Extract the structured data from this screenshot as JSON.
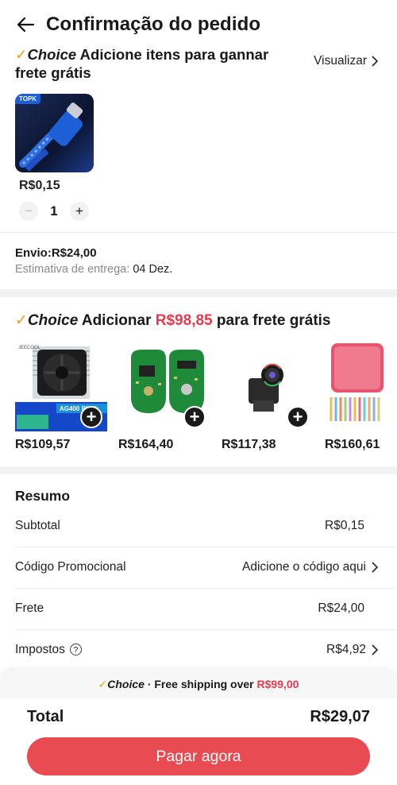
{
  "header": {
    "title": "Confirmação do pedido"
  },
  "choice_promo": {
    "choice_label": "Choice",
    "text": "Adicione itens para gannar frete grátis",
    "link": "Visualizar"
  },
  "cart_item": {
    "brand_tag": "TOPK",
    "price": "R$0,15",
    "quantity": "1"
  },
  "shipping": {
    "label": "Envio:R$24,00",
    "delivery_label": "Estimativa de entrega:",
    "delivery_date": "04 Dez."
  },
  "add_more": {
    "choice_label": "Choice",
    "text_before": "Adicionar",
    "amount": "R$98,85",
    "text_after": "para frete grátis",
    "items": [
      {
        "price": "R$109,57",
        "image": "cpu-cooler",
        "caption": "AG400 Black"
      },
      {
        "price": "R$164,40",
        "image": "circuit-boards"
      },
      {
        "price": "R$117,38",
        "image": "camera-module"
      },
      {
        "price": "R$160,61",
        "image": "pink-case"
      }
    ]
  },
  "summary": {
    "title": "Resumo",
    "rows": [
      {
        "label": "Subtotal",
        "value": "R$0,15"
      },
      {
        "label": "Código Promocional",
        "value": "Adicione o código aqui"
      },
      {
        "label": "Frete",
        "value": "R$24,00"
      },
      {
        "label": "Impostos",
        "value": "R$4,92"
      }
    ]
  },
  "footer": {
    "choice_label": "Choice",
    "banner_text": "· Free shipping over",
    "banner_amount": "R$99,00",
    "total_label": "Total",
    "total_value": "R$29,07",
    "pay_label": "Pagar agora"
  },
  "colors": {
    "accent_red": "#e8394d",
    "button_red": "#e84b52",
    "choice_check": "#f0a01a"
  }
}
